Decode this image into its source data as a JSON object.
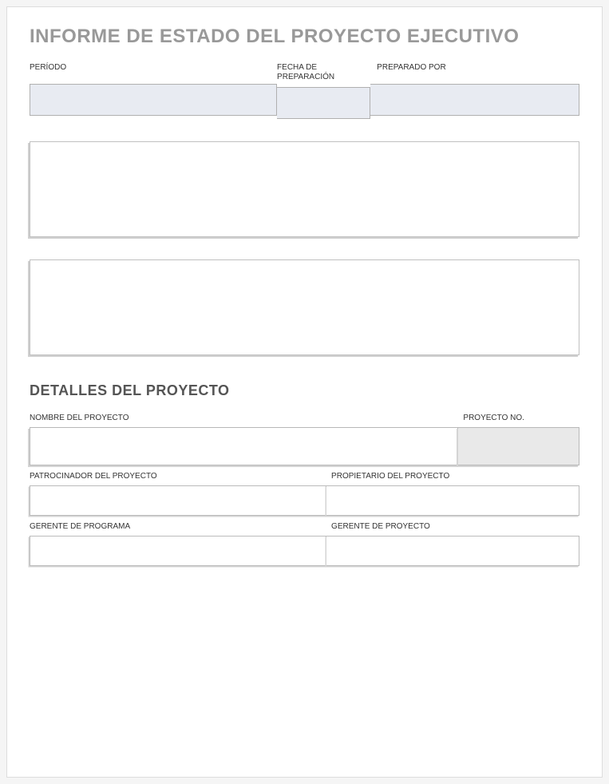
{
  "header": {
    "title": "INFORME DE ESTADO DEL PROYECTO EJECUTIVO"
  },
  "top_section": {
    "period_label": "PERÍODO",
    "period_value": "",
    "prep_date_label": "FECHA DE PREPARACIÓN",
    "prep_date_value": "",
    "prepared_by_label": "PREPARADO POR",
    "prepared_by_value": ""
  },
  "text_box_1": "",
  "text_box_2": "",
  "details": {
    "section_title": "DETALLES DEL PROYECTO",
    "project_name_label": "NOMBRE DEL PROYECTO",
    "project_name_value": "",
    "project_no_label": "PROYECTO NO.",
    "project_no_value": "",
    "sponsor_label": "PATROCINADOR DEL PROYECTO",
    "sponsor_value": "",
    "owner_label": "PROPIETARIO DEL PROYECTO",
    "owner_value": "",
    "program_manager_label": "GERENTE DE PROGRAMA",
    "program_manager_value": "",
    "project_manager_label": "GERENTE DE PROYECTO",
    "project_manager_value": ""
  }
}
